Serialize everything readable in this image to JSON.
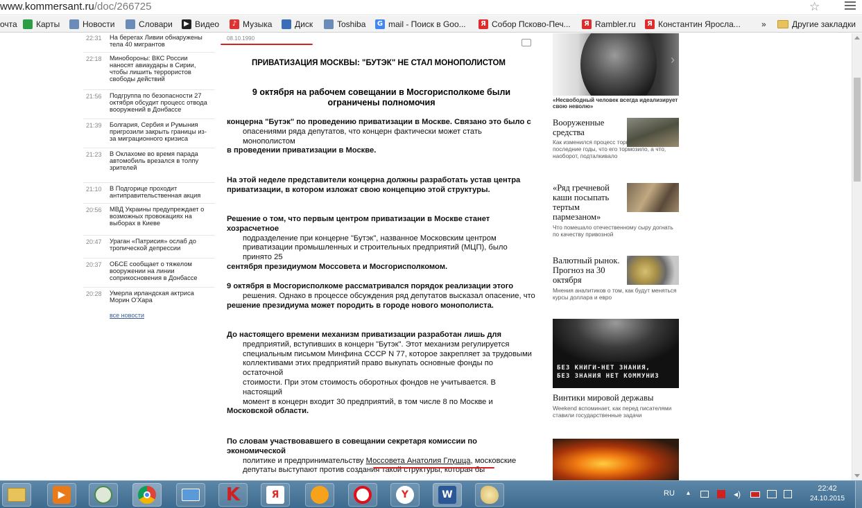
{
  "browser": {
    "url_host": "www.kommersant.ru",
    "url_path": "/doc/266725",
    "bookmarks": [
      {
        "label": "очта",
        "icon": "mail-icon",
        "color": "#ffffff"
      },
      {
        "label": "Карты",
        "icon": "maps-icon",
        "color": "#2c9f45"
      },
      {
        "label": "Новости",
        "icon": "page-icon",
        "color": "#6b8cb8"
      },
      {
        "label": "Словари",
        "icon": "page-icon",
        "color": "#6b8cb8"
      },
      {
        "label": "Видео",
        "icon": "play-icon",
        "color": "#222222"
      },
      {
        "label": "Музыка",
        "icon": "music-icon",
        "color": "#d33"
      },
      {
        "label": "Диск",
        "icon": "disk-icon",
        "color": "#3a6fb5"
      },
      {
        "label": "Toshiba",
        "icon": "page-icon",
        "color": "#6b8cb8"
      },
      {
        "label": "mail - Поиск в Goo...",
        "icon": "google-icon",
        "color": "#4285f4"
      },
      {
        "label": "Собор Псково-Печ...",
        "icon": "yandex-icon",
        "color": "#e02b2b"
      },
      {
        "label": "Rambler.ru",
        "icon": "yandex-icon",
        "color": "#e02b2b"
      },
      {
        "label": "Константин Яросла...",
        "icon": "yandex-icon",
        "color": "#e02b2b"
      },
      {
        "label": "»",
        "icon": "",
        "color": ""
      },
      {
        "label": "Другие закладки",
        "icon": "folder-icon",
        "color": "#e8c25a"
      }
    ]
  },
  "news": [
    {
      "time": "22:31",
      "text": "На берегах Ливии обнаружены тела 40 мигрантов"
    },
    {
      "time": "22:18",
      "text": "Минобороны: ВКС России наносят авиаудары в Сирии, чтобы лишить террористов свободы действий"
    },
    {
      "time": "21:56",
      "text": "Подгруппа по безопасности 27 октября обсудит процесс отвода вооружений в Донбассе"
    },
    {
      "time": "21:39",
      "text": "Болгария, Сербия и Румыния пригрозили закрыть границы из-за миграционного кризиса"
    },
    {
      "time": "21:23",
      "text": "В Оклахоме во время парада автомобиль врезался в толпу зрителей"
    },
    {
      "time": "21:10",
      "text": "В Подгорице проходит антиправительственная акция"
    },
    {
      "time": "20:56",
      "text": "МВД Украины предупреждает о возможных провокациях на выборах в Киеве"
    },
    {
      "time": "20:47",
      "text": "Ураган «Патрисия» ослаб до тропической депрессии"
    },
    {
      "time": "20:37",
      "text": "ОБСЕ сообщает о тяжелом вооружении на линии соприкосновения в Донбассе"
    },
    {
      "time": "20:28",
      "text": "Умерла ирландская актриса Морин О'Хара"
    }
  ],
  "all_news": "все новости",
  "article": {
    "date": "08.10.1990",
    "title": "ПРИВАТИЗАЦИЯ МОСКВЫ: \"БУТЭК\" НЕ СТАЛ МОНОПОЛИСТОМ",
    "subtitle": "9 октября на рабочем совещании в Мосгорисполкоме были ограничены полномочия",
    "paragraphs": [
      [
        {
          "t": "концерна \"Бутэк\" по проведению приватизации в Москве. Связано это было с",
          "s": "b"
        },
        {
          "t": "опасениями ряда депутатов, что концерн фактически может стать монополистом",
          "s": "ind"
        },
        {
          "t": "в проведении приватизации в Москве.",
          "s": "b"
        }
      ],
      [
        {
          "t": "На этой неделе представители концерна должны разработать устав центра",
          "s": "b"
        },
        {
          "t": "приватизации, в котором изложат свою концепцию этой структуры.",
          "s": "b"
        }
      ],
      [
        {
          "t": "Решение о том, что первым центром приватизации в Москве станет хозрасчетное",
          "s": "b"
        },
        {
          "t": "подразделение при концерне \"Бутэк\", названное Московским центром",
          "s": "ind"
        },
        {
          "t": "приватизации промышленных и строительных предприятий (МЦП), было принято 25",
          "s": "ind"
        },
        {
          "t": "сентября президиумом Моссовета и Мосгорисполкомом.",
          "s": "b"
        }
      ],
      [
        {
          "t": "9 октября в Мосгорисполкоме рассматривался порядок реализации этого",
          "s": "b"
        },
        {
          "t": "решения. Однако в процессе обсуждения ряд депутатов высказал опасение, что",
          "s": "ind"
        },
        {
          "t": "решение президиума может породить в городе нового монополиста.",
          "s": "b"
        }
      ],
      [
        {
          "t": "До настоящего времени механизм приватизации разработан лишь для",
          "s": "b"
        },
        {
          "t": "предприятий, вступивших в концерн \"Бутэк\". Этот механизм регулируется",
          "s": "ind"
        },
        {
          "t": "специальным письмом Минфина СССР N 77, которое закрепляет за трудовыми",
          "s": "ind"
        },
        {
          "t": "коллективами этих предприятий право выкупать основные фонды по остаточной",
          "s": "ind"
        },
        {
          "t": "стоимости. При этом стоимость оборотных фондов не учитывается. В настоящий",
          "s": "ind"
        },
        {
          "t": "момент в концерн входит 30 предприятий, в том числе 8 по Москве и",
          "s": "ind"
        },
        {
          "t": "Московской области.",
          "s": "b"
        }
      ],
      [
        {
          "t": "По словам участвовавшего в совещании секретаря комиссии по экономической",
          "s": "b"
        },
        {
          "t": "политике и предпринимательству Моссовета Анатолия Глушца, московские",
          "s": "ind"
        },
        {
          "t": "депутаты выступают против создания такой структуры, которая бы",
          "s": "ind"
        }
      ]
    ],
    "underline_fragment": "Моссовета Анатолия Глушца,"
  },
  "sidebar": {
    "hero_caption": "«Несвободный человек всегда идеализирует свою неволю»",
    "items": [
      {
        "title": "Вооруженные средства",
        "desc": "Как изменился процесс торговли оружием за последние годы, что его тормозило, а что, наоборот, подталкивало"
      },
      {
        "title": "«Ряд гречневой каши посыпать тертым пармезаном»",
        "desc": "Что помешало отечественному сыру догнать по качеству привозной"
      },
      {
        "title": "Валютный рынок. Прогноз на 30 октября",
        "desc": "Мнения аналитиков о том, как будут меняться курсы доллара и евро"
      },
      {
        "title": "Винтики мировой державы",
        "desc": "Weekend вспоминает, как перед писателями ставили государственные задачи"
      }
    ],
    "poster_text_1": "БЕЗ КНИГИ-НЕТ ЗНАНИЯ,",
    "poster_text_2": "БЕЗ ЗНАНИЯ НЕТ КОММУНИЗ"
  },
  "taskbar": {
    "lang": "RU",
    "time": "22:42",
    "date": "24.10.2015",
    "apps": [
      "explorer-icon",
      "media-player-icon",
      "security-icon",
      "chrome-icon",
      "mail-icon",
      "kaspersky-icon",
      "yandex-icon",
      "ok-icon",
      "opera-icon",
      "yandex-browser-icon",
      "word-icon",
      "paint-icon"
    ]
  },
  "colors": {
    "accent_red": "#d42222",
    "link_blue": "#3a5b9a",
    "taskbar": "#4a77a0"
  }
}
